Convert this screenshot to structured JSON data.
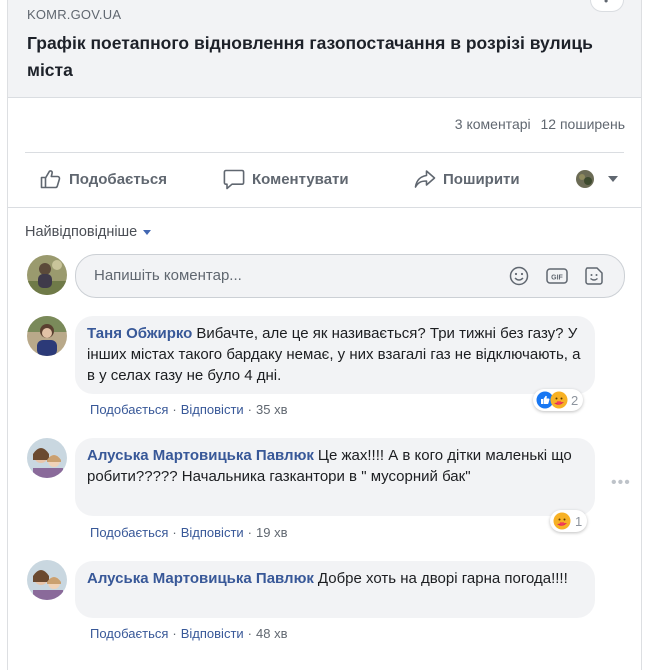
{
  "link_preview": {
    "domain": "KOMR.GOV.UA",
    "title": "Графік поетапного відновлення газопостачання в розрізі вулиць міста"
  },
  "stats": {
    "comments": "3 коментарі",
    "shares": "12 поширень"
  },
  "actions": {
    "like": "Подобається",
    "comment": "Коментувати",
    "share": "Поширити"
  },
  "sort": {
    "label": "Найвідповідніше"
  },
  "composer": {
    "placeholder": "Напишіть коментар..."
  },
  "comments": [
    {
      "author": "Таня Обжирко",
      "text": "Вибачте, але це як називається? Три тижні без газу? У інших містах такого бардаку немає, у них взагалі газ не відключають, а в у селах газу не було 4 дні.",
      "like": "Подобається",
      "reply": "Відповісти",
      "time": "35 хв",
      "reaction_count": "2"
    },
    {
      "author": "Алуська Мартовицька Павлюк",
      "text": "Це жах!!!! А в кого дітки маленькі що робити????? Начальника газкантори в \" мусорний бак\"",
      "like": "Подобається",
      "reply": "Відповісти",
      "time": "19 хв",
      "reaction_count": "1"
    },
    {
      "author": "Алуська Мартовицька Павлюк",
      "text": "Добре хоть на дворі гарна погода!!!!",
      "like": "Подобається",
      "reply": "Відповісти",
      "time": "48 хв"
    }
  ],
  "colors": {
    "link_blue": "#385898",
    "meta_gray": "#606770",
    "bubble_bg": "#f2f3f5",
    "like_blue": "#1877f2"
  }
}
